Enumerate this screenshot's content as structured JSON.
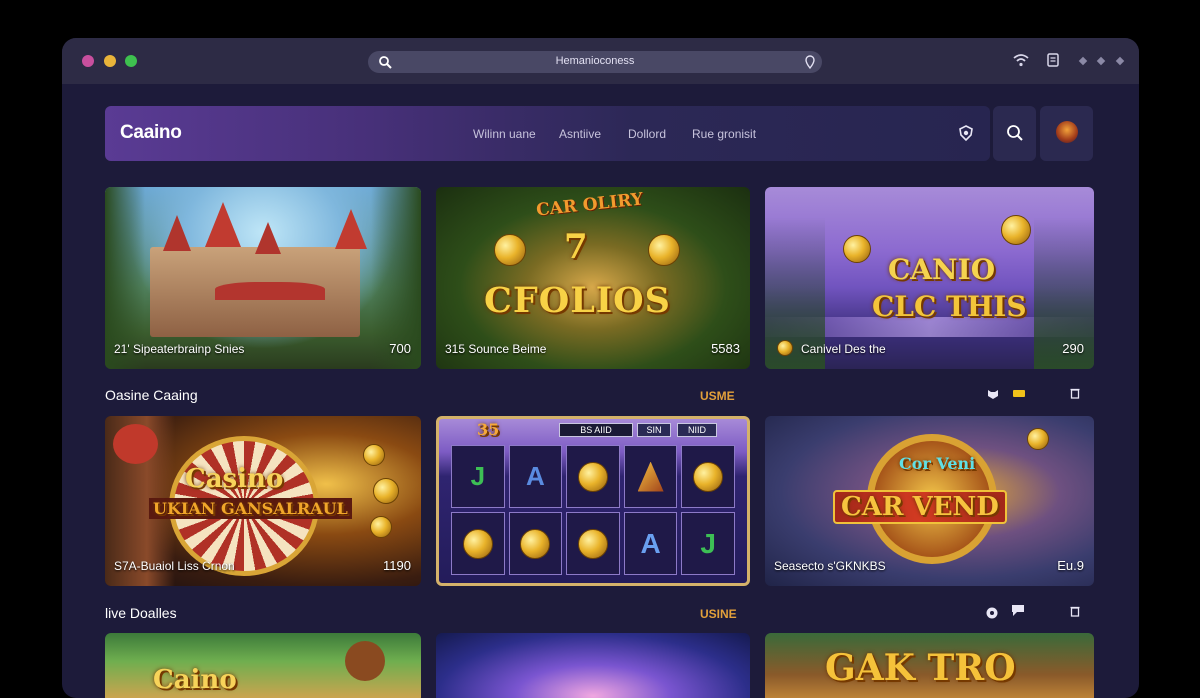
{
  "browser": {
    "address": "Hemanioconess"
  },
  "navbar": {
    "logo": "Caaino",
    "links": [
      "Wilinn uane",
      "Asntiive",
      "Dollord",
      "Rue gronisit"
    ]
  },
  "sections": [
    {
      "cards": [
        {
          "label": "21' Sipeaterbrainp Snies",
          "value": "700"
        },
        {
          "label": "315 Sounce Beime",
          "value": "5583"
        },
        {
          "label": "Canivel Des the",
          "value": "290",
          "art_title_top": "CANIO",
          "art_title_bottom": "CLC THIS"
        }
      ]
    },
    {
      "title": "Oasine Caaing",
      "link": "USME",
      "cards": [
        {
          "label": "S7A-Buaiol Liss Crnon",
          "value": "1190",
          "art_title_top": "Casino",
          "art_title_bottom": "UKIAN GANSALRAUL"
        },
        {
          "label": "",
          "value": "",
          "reel_header": [
            "BS AIID",
            "SIN",
            "NIID"
          ],
          "reel_corner": "35"
        },
        {
          "label": "Seasecto s'GKNKBS",
          "value": "Eu.9",
          "art_title_top": "Cor Veni",
          "art_title_bottom": "CAR VEND"
        }
      ]
    },
    {
      "title": "live Doalles",
      "link": "USINE",
      "cards": [
        {
          "art_title": "Caino"
        },
        {},
        {
          "art_title": "GAK TRO"
        }
      ]
    }
  ],
  "card2_art": {
    "top": "CAR OLIRY",
    "middle": "7",
    "bottom": "CFOLIOS"
  },
  "reel_symbols": [
    "J",
    "A",
    "",
    "",
    "",
    "",
    "",
    "",
    "A",
    "J"
  ],
  "colors": {
    "window_bg": "#1d1b3a",
    "titlebar": "#2d2b45",
    "accent_link": "#e2a03b",
    "brand_purple": "#5a3b94"
  }
}
